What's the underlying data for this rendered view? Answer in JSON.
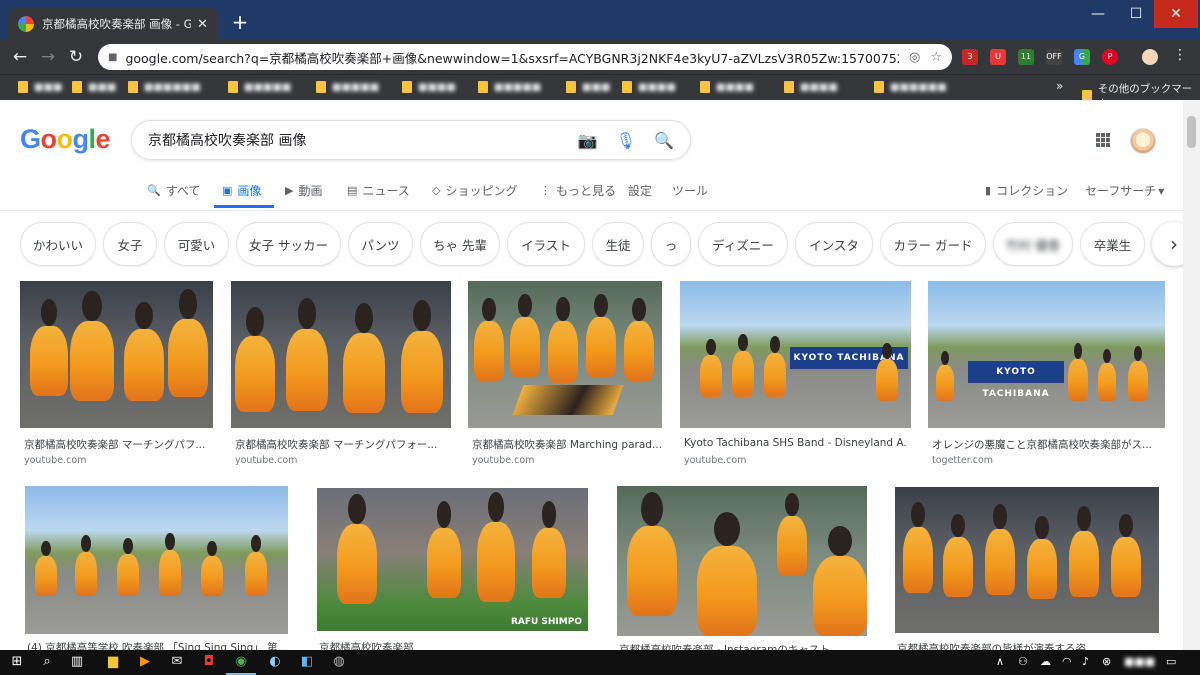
{
  "browser": {
    "tab_title": "京都橘高校吹奏楽部 画像 - Goog",
    "url": "google.com/search?q=京都橘高校吹奏楽部+画像&newwindow=1&sxsrf=ACYBGNR3j2NKF4e3kyU7-aZVLzsV3R05Zw:1570075227152&sou...",
    "bookmarks_other": "その他のブックマーク",
    "ext_badges": [
      "3",
      "11",
      "OFF"
    ]
  },
  "search": {
    "query": "京都橘高校吹奏楽部 画像"
  },
  "nav": {
    "tabs": [
      {
        "label": "すべて",
        "icon": "search-icon"
      },
      {
        "label": "画像",
        "icon": "image-icon",
        "active": true
      },
      {
        "label": "動画",
        "icon": "video-icon"
      },
      {
        "label": "ニュース",
        "icon": "news-icon"
      },
      {
        "label": "ショッピング",
        "icon": "tag-icon"
      },
      {
        "label": "もっと見る",
        "icon": "more-vert-icon"
      }
    ],
    "settings": "設定",
    "tools": "ツール",
    "collection": "コレクション",
    "safesearch": "セーフサーチ"
  },
  "chips": [
    "かわいい",
    "女子",
    "可愛い",
    "女子 サッカー",
    "パンツ",
    "ちゃ 先輩",
    "イラスト",
    "生徒",
    "っ",
    "ディズニー",
    "インスタ",
    "カラー ガード",
    "竹村 優香",
    "卒業生"
  ],
  "results_row1": [
    {
      "caption": "京都橘高校吹奏楽部 マーチングパフ...",
      "source": "youtube.com"
    },
    {
      "caption": "京都橘高校吹奏楽部 マーチングパフォー...",
      "source": "youtube.com"
    },
    {
      "caption": "京都橘高校吹奏楽部 Marching parad...",
      "source": "youtube.com"
    },
    {
      "caption": "Kyoto Tachibana SHS Band - Disneyland A...",
      "source": "youtube.com"
    },
    {
      "caption": "オレンジの悪魔こと京都橘高校吹奏楽部がス...",
      "source": "togetter.com"
    }
  ],
  "results_row2": [
    {
      "caption": "(4) 京都橘高等学校 吹奏楽部 「Sing Sing Sing」 第...",
      "watermark": ""
    },
    {
      "caption": "京都橘高校吹奏楽部",
      "watermark": "RAFU SHIMPO"
    },
    {
      "caption": "京都橘高校吹奏楽部 - Instagramのキャスト...",
      "watermark": ""
    },
    {
      "caption": "京都橘高校吹奏楽部の皆様が演奏する姿...",
      "watermark": ""
    }
  ],
  "banners": {
    "r4": "KYOTO TACHIBANA",
    "r5": "KYOTO TACHIBANA"
  },
  "colors": {
    "uniform_orange": "#f39a1e",
    "google_blue": "#1a73e8",
    "titlebar": "#1f3a66"
  }
}
